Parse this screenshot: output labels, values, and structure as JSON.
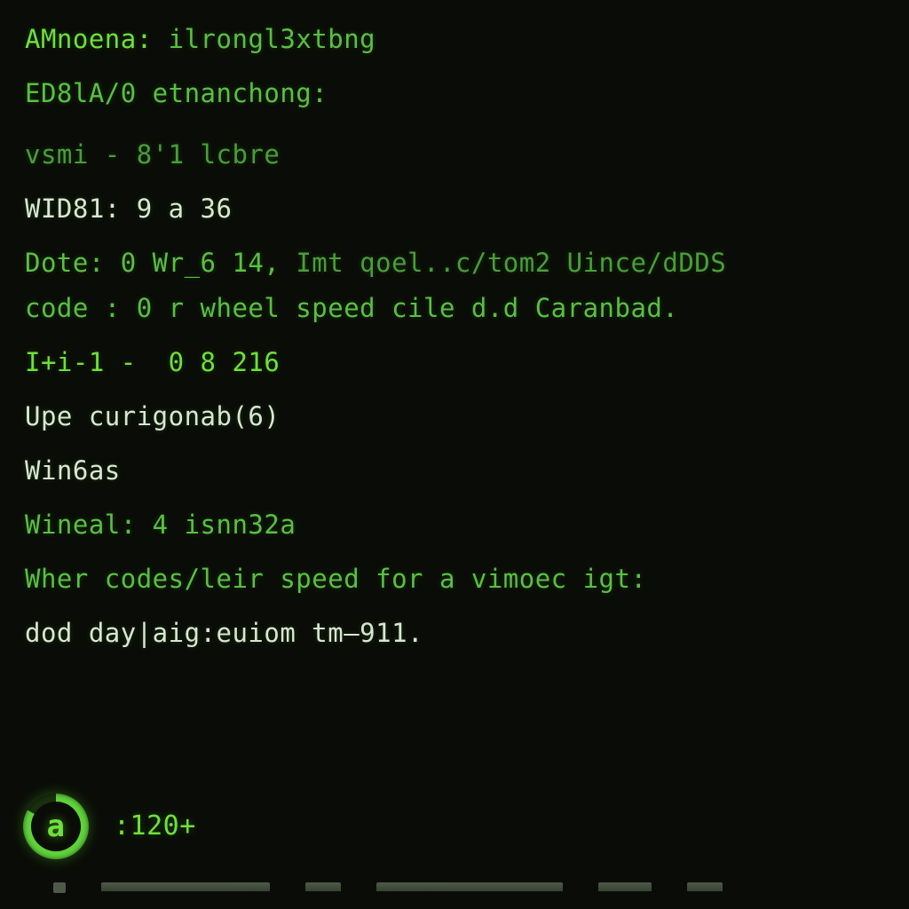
{
  "colors": {
    "bg": "#0a0d07",
    "white": "#d9e6d4",
    "green_bright": "#6fe03a",
    "green_med": "#5bbf44",
    "green_dim": "#4a9e3a",
    "ring": "#5fd33a"
  },
  "lines": [
    {
      "classes": "ln gb",
      "segments": [
        {
          "cls": "gb",
          "t": "AMnoena: "
        },
        {
          "cls": "gm",
          "t": "ilrongl3xtbng"
        }
      ]
    },
    {
      "classes": "ln gm loose",
      "segments": [
        {
          "cls": "gm",
          "t": "ED8lA/0 etnanchong:"
        }
      ]
    },
    {
      "classes": "ln gd",
      "segments": [
        {
          "cls": "gd",
          "t": "vsmi - 8'1 lcbre"
        }
      ]
    },
    {
      "classes": "ln w",
      "segments": [
        {
          "cls": "w",
          "t": "WID81: 9 a 36"
        }
      ]
    },
    {
      "classes": "ln gm tight",
      "segments": [
        {
          "cls": "gm",
          "t": "Dote: 0 Wr_6 14,"
        },
        {
          "cls": "gd",
          "t": " Imt qoel..c/tom2 Uince/dDDS"
        }
      ]
    },
    {
      "classes": "ln gm",
      "segments": [
        {
          "cls": "gm",
          "t": "code : 0 r wheel speed cile d.d Caranbad."
        }
      ]
    },
    {
      "classes": "ln gb",
      "segments": [
        {
          "cls": "gb",
          "t": "I+i-1 -  0 8 216"
        }
      ]
    },
    {
      "classes": "ln w",
      "segments": [
        {
          "cls": "w",
          "t": "Upe curigonab(6)"
        }
      ]
    },
    {
      "classes": "ln w",
      "segments": [
        {
          "cls": "w",
          "t": "Win6as"
        }
      ]
    },
    {
      "classes": "ln gm",
      "segments": [
        {
          "cls": "gm",
          "t": "Wineal: 4 isnn32a"
        }
      ]
    },
    {
      "classes": "ln gm",
      "segments": [
        {
          "cls": "gm",
          "t": "Wher codes/leir speed for a vimoec igt:"
        }
      ]
    },
    {
      "classes": "ln w",
      "segments": [
        {
          "cls": "w",
          "t": "dod day|aig:euiom tm—911."
        }
      ]
    }
  ],
  "badge": {
    "glyph": "a",
    "value": ":120+"
  }
}
